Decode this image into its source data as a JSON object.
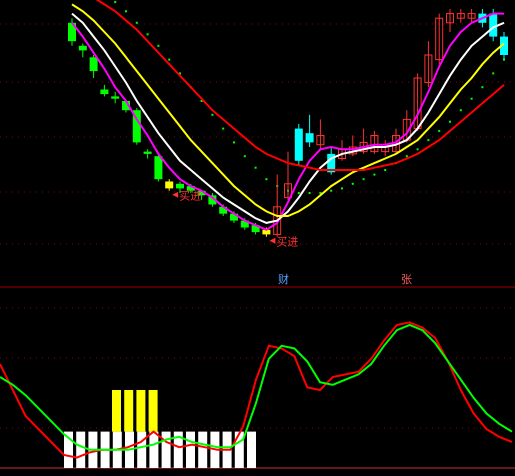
{
  "chart_data": [
    {
      "type": "candlestick",
      "panel": "price",
      "ylim": [
        0,
        100
      ],
      "grid": true,
      "colors": {
        "up": "#00ffff",
        "up_hollow": "#ff3232",
        "down": "#00ff00",
        "highlight": "#ffff00",
        "grid": "#8b0000"
      },
      "candles": [
        {
          "o": 96,
          "c": 104,
          "h": 106,
          "l": 94,
          "dir": "down"
        },
        {
          "o": 92,
          "c": 94,
          "h": 95,
          "l": 89,
          "dir": "down"
        },
        {
          "o": 83,
          "c": 89,
          "h": 90,
          "l": 80,
          "dir": "down"
        },
        {
          "o": 73,
          "c": 75,
          "h": 77,
          "l": 72,
          "dir": "down"
        },
        {
          "o": 71,
          "c": 72,
          "h": 74,
          "l": 69,
          "dir": "down"
        },
        {
          "o": 66,
          "c": 70,
          "h": 70,
          "l": 65,
          "dir": "down"
        },
        {
          "o": 52,
          "c": 66,
          "h": 67,
          "l": 51,
          "dir": "down"
        },
        {
          "o": 47,
          "c": 48,
          "h": 49,
          "l": 45,
          "dir": "down"
        },
        {
          "o": 36,
          "c": 46,
          "h": 47,
          "l": 35,
          "dir": "down"
        },
        {
          "o": 32,
          "c": 35,
          "h": 36,
          "l": 31,
          "dir": "highlight"
        },
        {
          "o": 32,
          "c": 34,
          "h": 35,
          "l": 30,
          "dir": "down"
        },
        {
          "o": 31,
          "c": 33,
          "h": 34,
          "l": 30,
          "dir": "down"
        },
        {
          "o": 29,
          "c": 31,
          "h": 31,
          "l": 27,
          "dir": "down"
        },
        {
          "o": 25,
          "c": 29,
          "h": 30,
          "l": 24,
          "dir": "down"
        },
        {
          "o": 21,
          "c": 24,
          "h": 25,
          "l": 20,
          "dir": "down"
        },
        {
          "o": 18,
          "c": 21,
          "h": 22,
          "l": 17,
          "dir": "down"
        },
        {
          "o": 15,
          "c": 18,
          "h": 19,
          "l": 14,
          "dir": "down"
        },
        {
          "o": 13,
          "c": 16,
          "h": 17,
          "l": 12,
          "dir": "down"
        },
        {
          "o": 12,
          "c": 14,
          "h": 15,
          "l": 11,
          "dir": "highlight"
        },
        {
          "o": 12,
          "c": 24,
          "h": 38,
          "l": 11,
          "dir": "up_hollow"
        },
        {
          "o": 28,
          "c": 34,
          "h": 48,
          "l": 27,
          "dir": "up_hollow"
        },
        {
          "o": 44,
          "c": 58,
          "h": 60,
          "l": 42,
          "dir": "up"
        },
        {
          "o": 52,
          "c": 56,
          "h": 64,
          "l": 50,
          "dir": "up"
        },
        {
          "o": 51,
          "c": 55,
          "h": 62,
          "l": 49,
          "dir": "up_hollow"
        },
        {
          "o": 39,
          "c": 47,
          "h": 50,
          "l": 38,
          "dir": "up"
        },
        {
          "o": 45,
          "c": 49,
          "h": 53,
          "l": 44,
          "dir": "up_hollow"
        },
        {
          "o": 47,
          "c": 50,
          "h": 55,
          "l": 46,
          "dir": "up_hollow"
        },
        {
          "o": 48,
          "c": 52,
          "h": 58,
          "l": 47,
          "dir": "up_hollow"
        },
        {
          "o": 48,
          "c": 55,
          "h": 57,
          "l": 47,
          "dir": "up_hollow"
        },
        {
          "o": 48,
          "c": 51,
          "h": 53,
          "l": 46,
          "dir": "up_hollow"
        },
        {
          "o": 48,
          "c": 55,
          "h": 58,
          "l": 47,
          "dir": "up_hollow"
        },
        {
          "o": 53,
          "c": 62,
          "h": 66,
          "l": 52,
          "dir": "up_hollow"
        },
        {
          "o": 58,
          "c": 80,
          "h": 82,
          "l": 57,
          "dir": "up_hollow"
        },
        {
          "o": 78,
          "c": 90,
          "h": 96,
          "l": 76,
          "dir": "up_hollow"
        },
        {
          "o": 88,
          "c": 106,
          "h": 108,
          "l": 86,
          "dir": "up_hollow"
        },
        {
          "o": 104,
          "c": 108,
          "h": 110,
          "l": 100,
          "dir": "up_hollow"
        },
        {
          "o": 106,
          "c": 108,
          "h": 110,
          "l": 104,
          "dir": "up_hollow"
        },
        {
          "o": 106,
          "c": 108,
          "h": 110,
          "l": 104,
          "dir": "up_hollow"
        },
        {
          "o": 104,
          "c": 108,
          "h": 110,
          "l": 102,
          "dir": "up"
        },
        {
          "o": 98,
          "c": 108,
          "h": 110,
          "l": 96,
          "dir": "up"
        },
        {
          "o": 90,
          "c": 98,
          "h": 100,
          "l": 88,
          "dir": "up"
        }
      ],
      "lines": [
        {
          "color": "#ff00ff",
          "values": [
            104,
            98,
            91,
            84,
            76,
            70,
            62,
            55,
            47,
            41,
            36,
            33,
            31,
            28,
            24,
            21,
            18,
            16,
            14,
            17,
            26,
            36,
            44,
            49,
            50,
            49,
            49,
            50,
            51,
            51,
            52,
            56,
            64,
            74,
            85,
            94,
            100,
            104,
            106,
            108,
            108
          ]
        },
        {
          "color": "#ffffff",
          "values": [
            108,
            104,
            98,
            92,
            85,
            78,
            70,
            63,
            56,
            50,
            44,
            40,
            36,
            32,
            28,
            25,
            22,
            19,
            17,
            18,
            22,
            28,
            35,
            41,
            45,
            47,
            48,
            49,
            50,
            50,
            51,
            53,
            58,
            65,
            73,
            81,
            88,
            94,
            98,
            102,
            104
          ]
        },
        {
          "color": "#ffff00",
          "values": [
            112,
            109,
            105,
            100,
            95,
            89,
            83,
            77,
            71,
            65,
            59,
            53,
            48,
            43,
            38,
            33,
            29,
            25,
            22,
            20,
            20,
            22,
            25,
            29,
            33,
            36,
            39,
            41,
            43,
            45,
            47,
            50,
            53,
            58,
            63,
            69,
            75,
            80,
            86,
            91,
            95
          ]
        },
        {
          "color": "#ff0000",
          "values": [
            120,
            118,
            115,
            112,
            109,
            105,
            101,
            96,
            91,
            86,
            81,
            76,
            71,
            66,
            62,
            58,
            54,
            50,
            47,
            45,
            43,
            42,
            41,
            40,
            40,
            40,
            40,
            40,
            41,
            42,
            43,
            45,
            47,
            50,
            53,
            57,
            61,
            65,
            69,
            73,
            77
          ]
        }
      ],
      "dot_line": {
        "color": "#00ff00",
        "values": [
          125,
          123,
          120,
          117,
          113,
          109,
          104,
          99,
          94,
          88,
          82,
          76,
          70,
          64,
          58,
          52,
          46,
          41,
          36,
          33,
          31,
          30,
          30,
          30,
          31,
          32,
          34,
          36,
          38,
          40,
          43,
          46,
          49,
          53,
          57,
          61,
          66,
          71,
          76,
          82,
          88
        ]
      },
      "annotations": [
        {
          "text": "买进",
          "index": 9,
          "value": 31,
          "color": "#ff3232"
        },
        {
          "text": "买进",
          "index": 18,
          "value": 11,
          "color": "#ff3232"
        }
      ]
    },
    {
      "type": "line",
      "panel": "oscillator",
      "ylim": [
        0,
        100
      ],
      "grid": true,
      "series": [
        {
          "color": "#ff0000",
          "values": [
            80,
            60,
            40,
            30,
            20,
            10,
            8,
            12,
            14,
            14,
            16,
            20,
            28,
            20,
            16,
            18,
            16,
            14,
            14,
            32,
            68,
            94,
            92,
            86,
            62,
            60,
            70,
            72,
            74,
            84,
            98,
            110,
            112,
            108,
            100,
            82,
            60,
            42,
            30,
            24,
            20
          ]
        },
        {
          "color": "#00ff00",
          "values": [
            70,
            64,
            56,
            46,
            36,
            26,
            18,
            14,
            14,
            14,
            14,
            16,
            18,
            22,
            24,
            20,
            18,
            16,
            16,
            22,
            50,
            84,
            94,
            92,
            82,
            66,
            64,
            68,
            72,
            80,
            94,
            106,
            110,
            106,
            96,
            82,
            68,
            54,
            42,
            34,
            28
          ]
        }
      ],
      "histogram": [
        {
          "value": 28,
          "color": "#ffffff"
        },
        {
          "value": 28,
          "color": "#ffffff"
        },
        {
          "value": 28,
          "color": "#ffffff"
        },
        {
          "value": 28,
          "color": "#ffffff"
        },
        {
          "value": 28,
          "color": "#ffffff"
        },
        {
          "value": 28,
          "color": "#ffffff"
        },
        {
          "value": 28,
          "color": "#ffffff"
        },
        {
          "value": 28,
          "color": "#ffffff"
        },
        {
          "value": 28,
          "color": "#ffffff"
        },
        {
          "value": 28,
          "color": "#ffffff"
        },
        {
          "value": 28,
          "color": "#ffffff"
        },
        {
          "value": 28,
          "color": "#ffffff"
        },
        {
          "value": 28,
          "color": "#ffffff"
        },
        {
          "value": 28,
          "color": "#ffffff"
        },
        {
          "value": 28,
          "color": "#ffffff"
        },
        {
          "value": 28,
          "color": "#ffffff"
        }
      ],
      "highlight_bars": [
        {
          "value": 60,
          "color": "#ffff00"
        },
        {
          "value": 60,
          "color": "#ffff00"
        },
        {
          "value": 60,
          "color": "#ffff00"
        },
        {
          "value": 60,
          "color": "#ffff00"
        }
      ]
    }
  ],
  "markers": {
    "cai": {
      "text": "财",
      "color": "#5aa0ff"
    },
    "zhang": {
      "text": "张",
      "color": "#ff5a5a"
    }
  }
}
